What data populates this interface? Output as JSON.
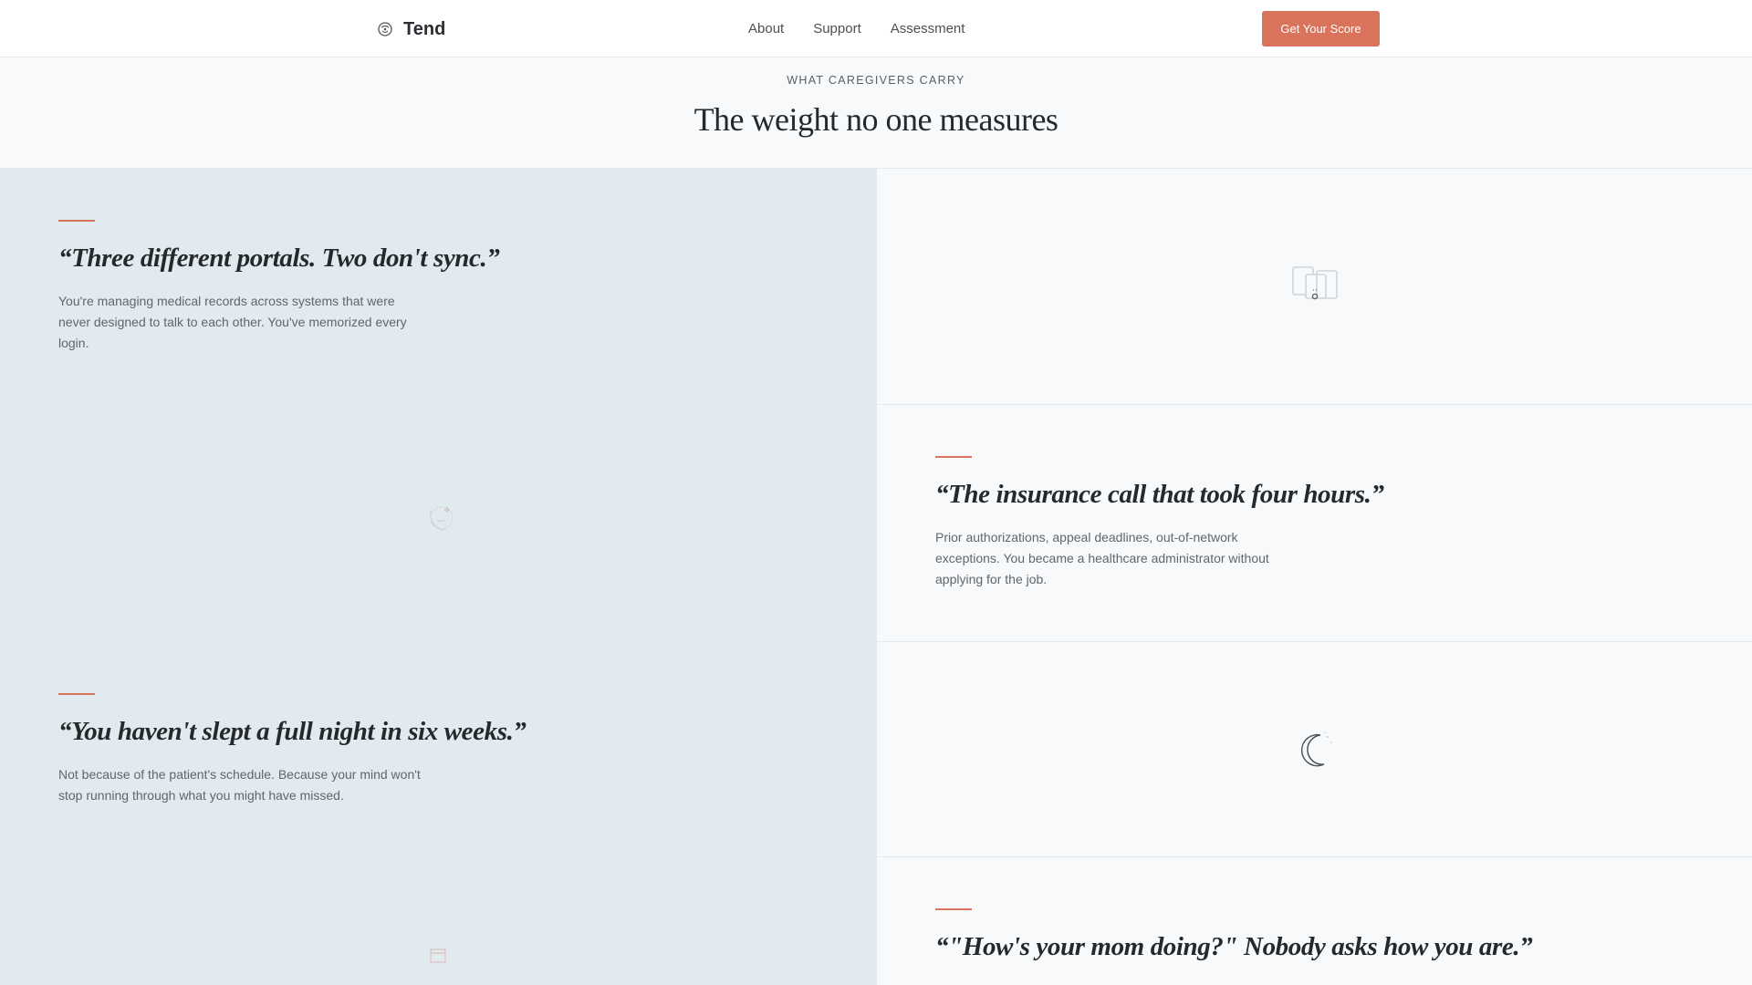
{
  "header": {
    "brand": "Tend",
    "nav": [
      "About",
      "Support",
      "Assessment"
    ],
    "cta_label": "Get Your Score"
  },
  "intro": {
    "eyebrow": "WHAT CAREGIVERS CARRY",
    "title": "The weight no one measures"
  },
  "cards": [
    {
      "quote": "“Three different portals. Two don't sync.”",
      "body": "You're managing medical records across systems that were never designed to talk to each other. You've memorized every login."
    },
    {
      "quote": "“The insurance call that took four hours.”",
      "body": "Prior authorizations, appeal deadlines, out-of-network exceptions. You became a healthcare administrator without applying for the job."
    },
    {
      "quote": "“You haven't slept a full night in six weeks.”",
      "body": "Not because of the patient's schedule. Because your mind won't stop running through what you might have missed."
    },
    {
      "quote": "“\"How's your mom doing?\" Nobody asks how you are.”",
      "body": ""
    }
  ],
  "icons": {
    "portals": "devices-icon",
    "phone": "phone-icon",
    "sleep": "moon-icon",
    "calendar": "calendar-icon",
    "brand": "tend-logo-icon"
  },
  "colors": {
    "accent": "#d9735c",
    "left_panel": "#e1eaee",
    "right_panel": "#f7f9fa"
  }
}
